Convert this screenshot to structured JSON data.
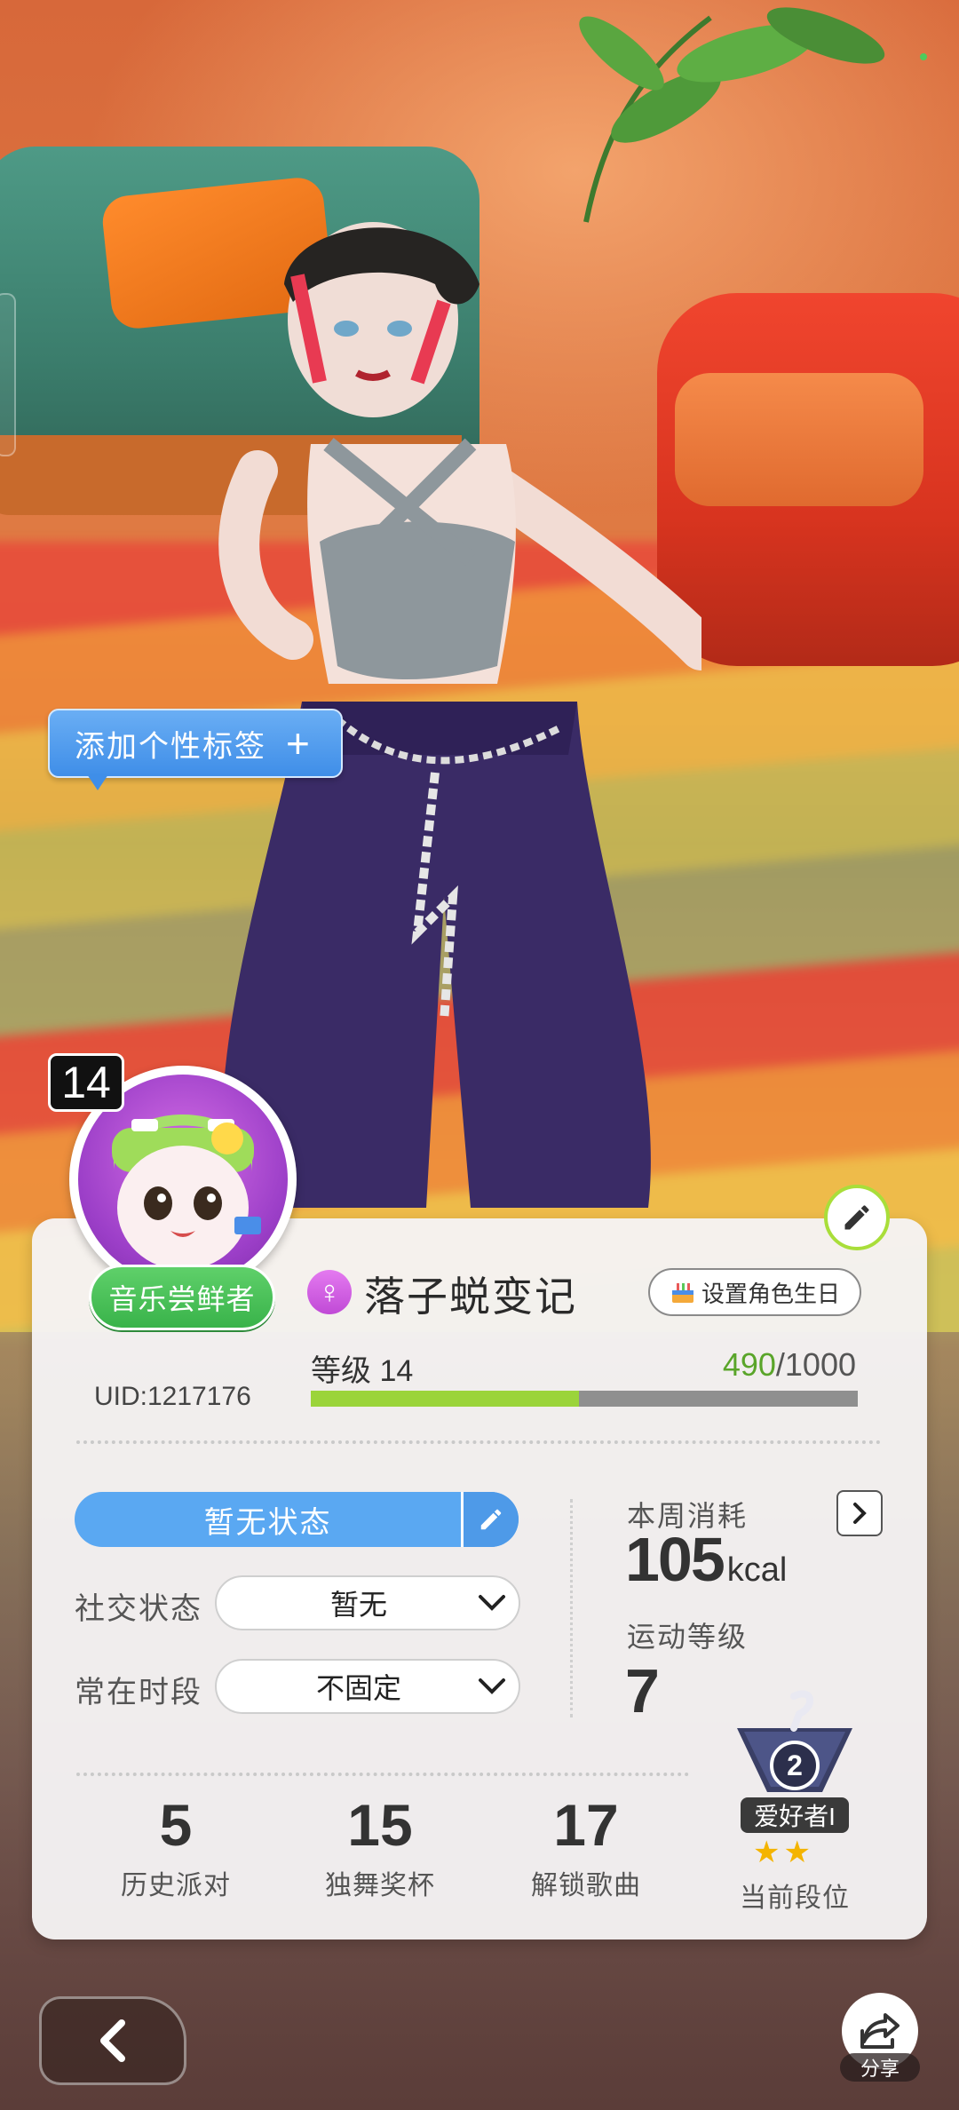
{
  "profile": {
    "level_badge": "14",
    "rank_title": "音乐尝鲜者",
    "nickname": "落子蜕变记",
    "gender_symbol": "♀",
    "birthday_button": "设置角色生日",
    "uid": "UID:1217176",
    "level_label": "等级 14",
    "exp_current": "490",
    "exp_total": "/1000",
    "exp_fraction": 0.49
  },
  "tag_bubble": {
    "label": "添加个性标签",
    "plus": "+"
  },
  "status": {
    "current": "暂无状态",
    "social_label": "社交状态",
    "social_value": "暂无",
    "online_label": "常在时段",
    "online_value": "不固定"
  },
  "fitness": {
    "week_label": "本周消耗",
    "kcal_value": "105",
    "kcal_unit": "kcal",
    "sport_level_label": "运动等级",
    "sport_level_value": "7"
  },
  "stats": [
    {
      "value": "5",
      "label": "历史派对"
    },
    {
      "value": "15",
      "label": "独舞奖杯"
    },
    {
      "value": "17",
      "label": "解锁歌曲"
    }
  ],
  "rank": {
    "emblem_number": "2",
    "title": "爱好者I",
    "stars": "★★",
    "label": "当前段位"
  },
  "bottom": {
    "share_label": "分享"
  },
  "icons": {
    "edit": "pencil-icon",
    "chevron": "chevron-down-icon",
    "arrow": "chevron-right-icon",
    "back": "chevron-left-icon",
    "share": "share-icon"
  },
  "colors": {
    "accent_blue": "#5aa8f2",
    "accent_green": "#9bd43a",
    "rank_green": "#39b34a",
    "gender_pink": "#c04ad6"
  }
}
